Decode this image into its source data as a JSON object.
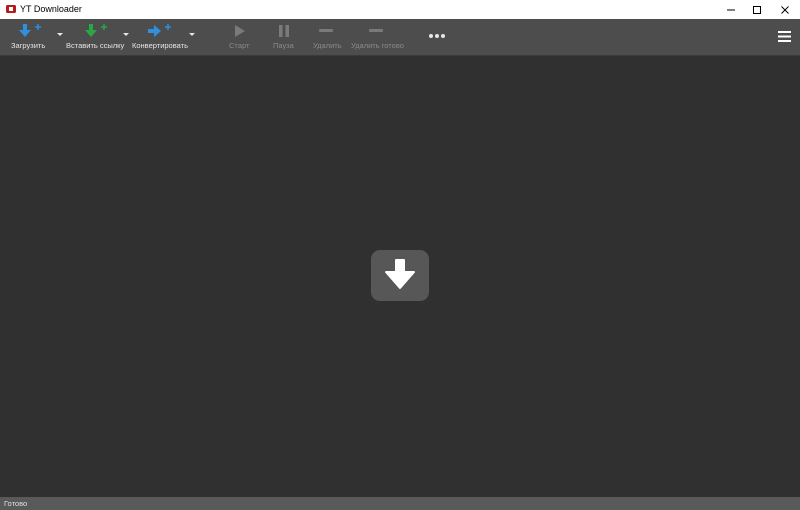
{
  "window": {
    "title": "YT Downloader",
    "controls": [
      "minimize",
      "maximize",
      "close"
    ]
  },
  "toolbar": {
    "download_label": "Загрузить",
    "paste_link_label": "Вставить ссылку",
    "convert_label": "Конвертировать",
    "start_label": "Старт",
    "pause_label": "Пауза",
    "delete_label": "Удалить",
    "delete_done_label": "Удалить готово",
    "more_icon": "ellipsis-icon",
    "menu_icon": "hamburger-icon"
  },
  "main": {
    "empty_state_icon": "download-arrow-icon"
  },
  "status": {
    "text": "Готово"
  },
  "colors": {
    "download_accent": "#2f8fe0",
    "paste_accent": "#28a745",
    "convert_accent": "#2f8fe0",
    "toolbar_bg": "#4d4d4d",
    "main_bg": "#303030",
    "statusbar_bg": "#595959"
  }
}
